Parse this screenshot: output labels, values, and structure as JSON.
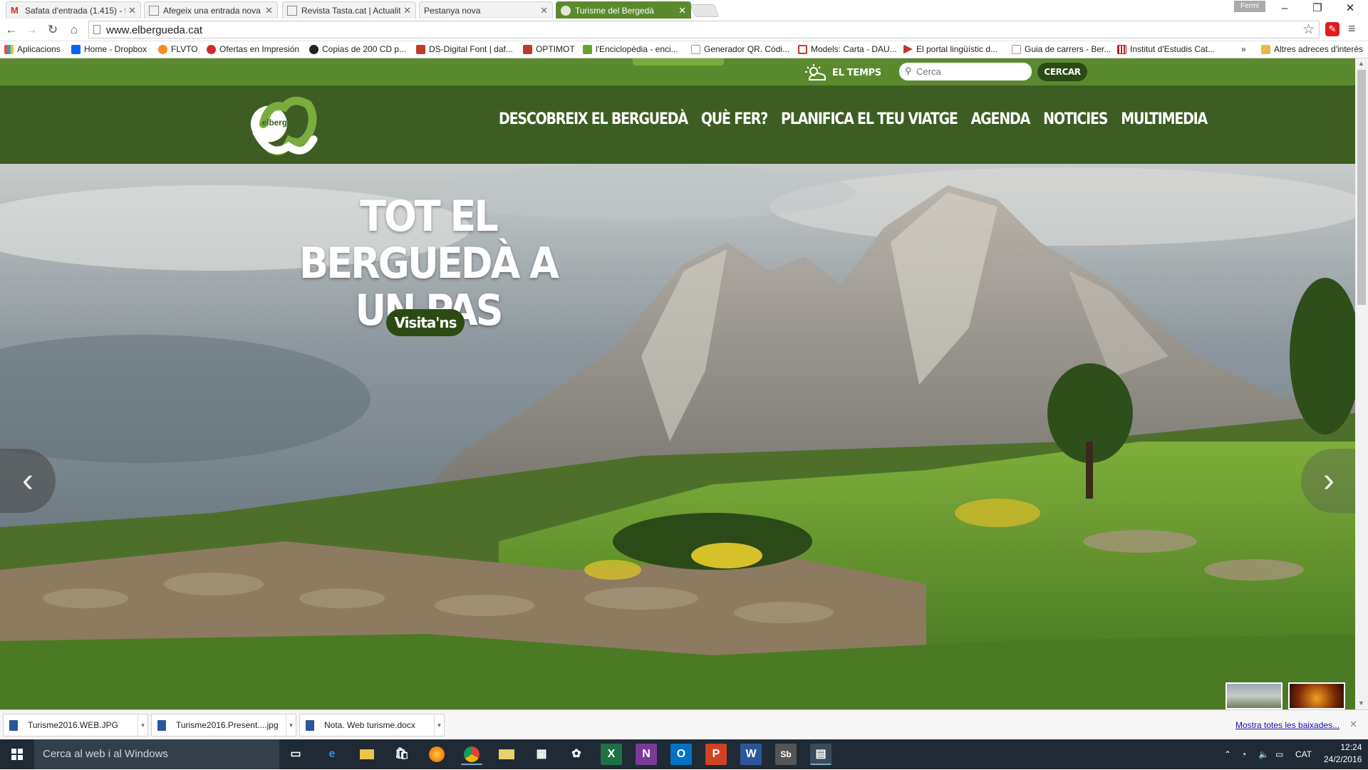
{
  "browser": {
    "tabs": [
      {
        "title": "Safata d'entrada (1.415) - f",
        "fav_color": "#d93025",
        "active": false
      },
      {
        "title": "Afegeix una entrada nova",
        "fav_color": "#888888",
        "active": false
      },
      {
        "title": "Revista Tasta.cat | Actualit",
        "fav_color": "#888888",
        "active": false
      },
      {
        "title": "Pestanya nova",
        "fav_color": "",
        "active": false
      },
      {
        "title": "Turisme del Bergedà",
        "fav_color": "#5b8a2e",
        "active": true
      }
    ],
    "profile_name": "Fermí",
    "url": "www.elbergueda.cat",
    "bookmarks": [
      {
        "label": "Aplicacions",
        "icon_color": "#3c8ae6"
      },
      {
        "label": "Home - Dropbox",
        "icon_color": "#0061fe"
      },
      {
        "label": "FLVTO",
        "icon_color": "#f28c28"
      },
      {
        "label": "Ofertas en Impresión",
        "icon_color": "#d22a2a"
      },
      {
        "label": "Copias de 200 CD p...",
        "icon_color": "#222222"
      },
      {
        "label": "DS-Digital Font | daf...",
        "icon_color": "#c0392b"
      },
      {
        "label": "OPTIMOT",
        "icon_color": "#c0392b"
      },
      {
        "label": "l'Enciclopèdia - enci...",
        "icon_color": "#6aa329"
      },
      {
        "label": "Generador QR. Códi...",
        "icon_color": "#999999"
      },
      {
        "label": "Models: Carta - DAU...",
        "icon_color": "#c0392b"
      },
      {
        "label": "El portal lingüístic d...",
        "icon_color": "#c0392b"
      },
      {
        "label": "Guia de carrers - Ber...",
        "icon_color": "#999999"
      },
      {
        "label": "Institut d'Estudis Cat...",
        "icon_color": "#b22222"
      }
    ],
    "bookmarks_overflow": "»",
    "other_bookmarks": "Altres adreces d'interès"
  },
  "site": {
    "weather_label": "EL TEMPS",
    "search_placeholder": "Cerca",
    "search_button": "CERCAR",
    "logo_text": "elbergueda",
    "nav": [
      "DESCOBREIX EL BERGUEDÀ",
      "QUÈ FER?",
      "PLANIFICA EL TEU VIATGE",
      "AGENDA",
      "NOTICIES",
      "MULTIMEDIA"
    ],
    "hero": {
      "title_line1": "TOT EL BERGUEDÀ A",
      "title_line2": "UN PAS",
      "cta": "Visita'ns"
    },
    "colors": {
      "topbar": "#5b8a2e",
      "header": "#3d5d23",
      "button": "#2c4a14"
    }
  },
  "downloads": {
    "items": [
      "Turisme2016.WEB.JPG",
      "Turisme2016.Present....jpg",
      "Nota. Web turisme.docx"
    ],
    "show_all": "Mostra totes les baixades..."
  },
  "taskbar": {
    "search_placeholder": "Cerca al web i al Windows",
    "language": "CAT",
    "time": "12:24",
    "date": "24/2/2016"
  }
}
